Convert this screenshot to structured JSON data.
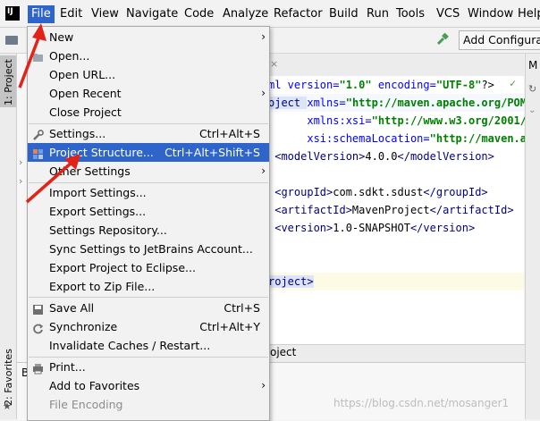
{
  "menubar": {
    "items": [
      {
        "label": "File"
      },
      {
        "label": "Edit"
      },
      {
        "label": "View"
      },
      {
        "label": "Navigate"
      },
      {
        "label": "Code"
      },
      {
        "label": "Analyze"
      },
      {
        "label": "Refactor"
      },
      {
        "label": "Build"
      },
      {
        "label": "Run"
      },
      {
        "label": "Tools"
      },
      {
        "label": "VCS"
      },
      {
        "label": "Window"
      },
      {
        "label": "Help"
      }
    ]
  },
  "toolbar": {
    "run_config": "Add Configura"
  },
  "left_tools": {
    "project_tab": "1: Project",
    "favorites_tab": "2: Favorites"
  },
  "right_panel": {
    "label": "M"
  },
  "file_menu": {
    "items": [
      {
        "label": "New",
        "shortcut": ""
      },
      {
        "label": "Open...",
        "shortcut": ""
      },
      {
        "label": "Open URL...",
        "shortcut": ""
      },
      {
        "label": "Open Recent",
        "shortcut": ""
      },
      {
        "label": "Close Project",
        "shortcut": ""
      },
      {
        "label": "Settings...",
        "shortcut": "Ctrl+Alt+S"
      },
      {
        "label": "Project Structure...",
        "shortcut": "Ctrl+Alt+Shift+S"
      },
      {
        "label": "Other Settings",
        "shortcut": ""
      },
      {
        "label": "Import Settings...",
        "shortcut": ""
      },
      {
        "label": "Export Settings...",
        "shortcut": ""
      },
      {
        "label": "Settings Repository...",
        "shortcut": ""
      },
      {
        "label": "Sync Settings to JetBrains Account...",
        "shortcut": ""
      },
      {
        "label": "Export Project to Eclipse...",
        "shortcut": ""
      },
      {
        "label": "Export to Zip File...",
        "shortcut": ""
      },
      {
        "label": "Save All",
        "shortcut": "Ctrl+S"
      },
      {
        "label": "Synchronize",
        "shortcut": "Ctrl+Alt+Y"
      },
      {
        "label": "Invalidate Caches / Restart...",
        "shortcut": ""
      },
      {
        "label": "Print...",
        "shortcut": ""
      },
      {
        "label": "Add to Favorites",
        "shortcut": ""
      },
      {
        "label": "File Encoding",
        "shortcut": ""
      }
    ]
  },
  "editor": {
    "lines": [
      {
        "a": "ml version=",
        "b": "\"1.0\"",
        "c": " encoding=",
        "d": "\"UTF-8\"",
        "e": "?>"
      },
      {
        "a": "oject ",
        "b": "xmlns=",
        "c": "\"http://maven.apache.org/POM/"
      },
      {
        "a": "      ",
        "b": "xmlns:xsi=",
        "c": "\"http://www.w3.org/2001/X"
      },
      {
        "a": "      ",
        "b": "xsi:schemaLocation=",
        "c": "\"http://maven.ap"
      },
      {
        "a": " <modelVersion>",
        "b": "4.0.0",
        "c": "</modelVersion>"
      },
      {
        "a": " <groupId>",
        "b": "com.sdkt.sdust",
        "c": "</groupId>"
      },
      {
        "a": " <artifactId>",
        "b": "MavenProject",
        "c": "</artifactId>"
      },
      {
        "a": " <version>",
        "b": "1.0-SNAPSHOT",
        "c": "</version>"
      },
      {
        "a": "roject>",
        "b": "",
        "c": ""
      }
    ]
  },
  "bottom_bar": {
    "label": "oject"
  },
  "bottom_panel": {
    "label": "B"
  },
  "watermark": "https://blog.csdn.net/mosanger1"
}
